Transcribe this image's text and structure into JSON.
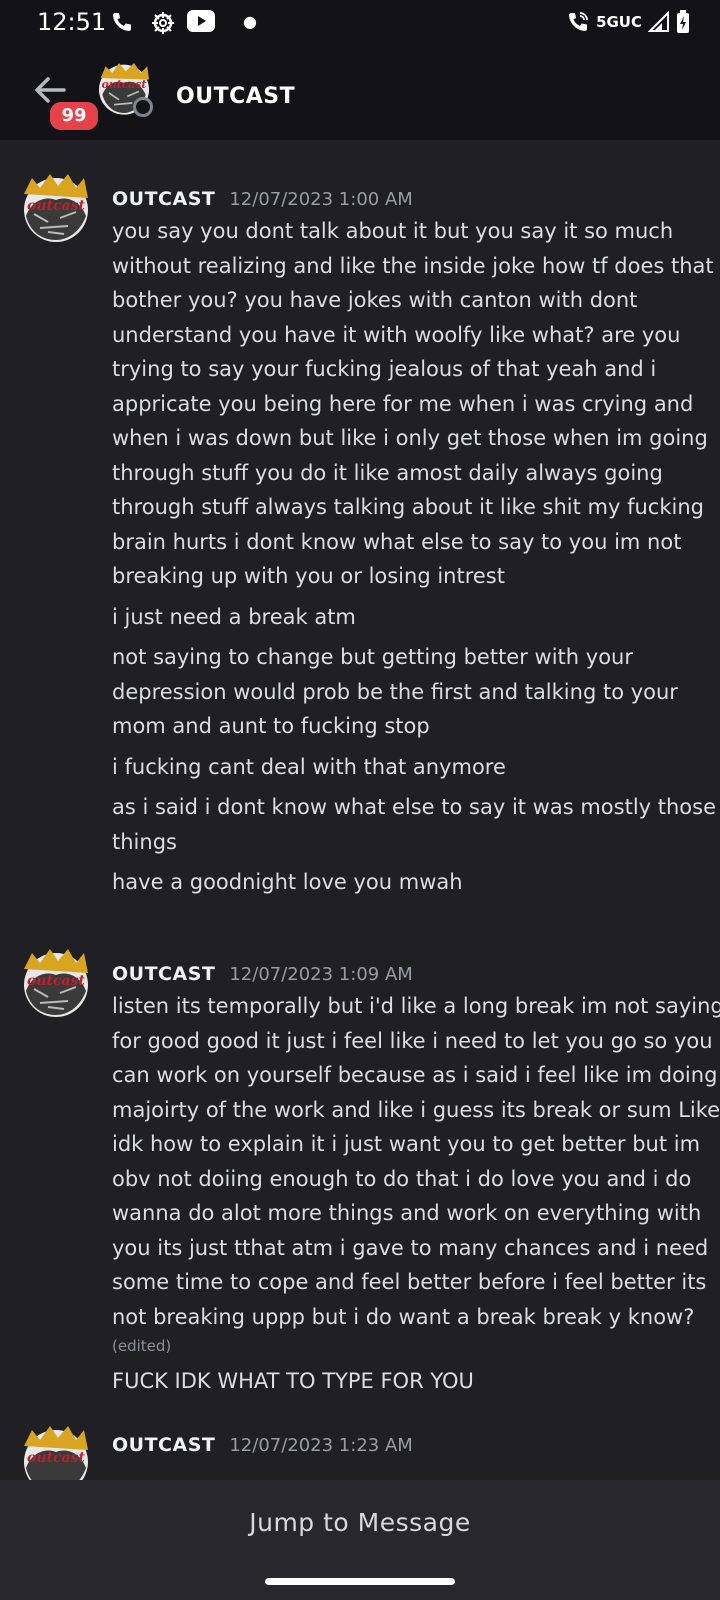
{
  "statusbar": {
    "time": "12:51",
    "network": "5GUC"
  },
  "header": {
    "title": "OUTCAST",
    "badge": "99"
  },
  "messages": [
    {
      "author": "OUTCAST",
      "time": "12/07/2023 1:00 AM",
      "lines": [
        [
          "you say you dont talk about it but you say it so much",
          "without realizing and like  the inside joke how tf does that",
          "bother you? you have jokes with canton with dont",
          "understand you have it with woolfy like what? are you",
          "trying to say your fucking jealous of that yeah and i",
          "appricate you being here for me when i was crying and",
          "when i was down but like i only get those when im going",
          "through stuff you do it like amost daily always going",
          "through stuff always talking about it like shit my fucking",
          "brain hurts i dont know what else  to say to you im not",
          "breaking up with you or losing intrest"
        ],
        [
          "i just need a break atm"
        ],
        [
          "not saying to change but getting better with your",
          "depression would prob be the first and talking to your",
          "mom and aunt to fucking stop"
        ],
        [
          "i fucking cant deal with that anymore"
        ],
        [
          "as i said i dont know what else to say it was mostly those",
          "things"
        ],
        [
          "have a goodnight love you mwah"
        ]
      ]
    },
    {
      "author": "OUTCAST",
      "time": "12/07/2023 1:09 AM",
      "lines": [
        [
          "listen its temporally but i'd like a long break im not saying",
          "for good good it just i feel like i need to let you go so you",
          "can work on yourself because as i said i feel like im doing",
          "majoirty of the work and like i guess its break or sum Like",
          "idk how to explain it i just want you to get better but im",
          "obv not doiing enough to do that i do love you and i do",
          "wanna do alot more things and work on everything with",
          "you its just tthat atm i gave to many chances and i need",
          "some time to cope and feel better before i feel better its",
          "not breaking uppp but i do want a break break y know?"
        ],
        [
          "FUCK IDK WHAT TO TYPE FOR YOU"
        ]
      ],
      "edited": "(edited)"
    },
    {
      "author": "OUTCAST",
      "time": "12/07/2023 1:23 AM"
    }
  ],
  "jump_label": "Jump to Message"
}
